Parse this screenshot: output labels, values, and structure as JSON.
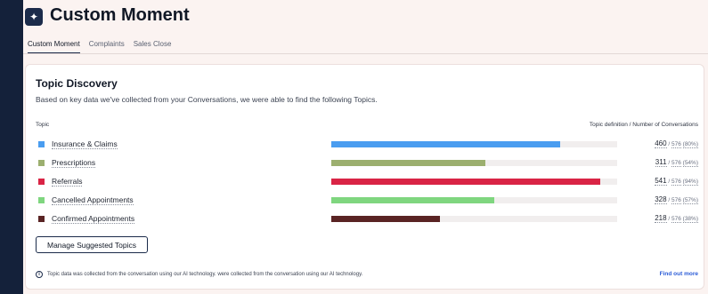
{
  "header": {
    "logo_glyph": "✦",
    "title": "Custom Moment"
  },
  "tabs": [
    {
      "label": "Custom Moment",
      "active": true
    },
    {
      "label": "Complaints",
      "active": false
    },
    {
      "label": "Sales Close",
      "active": false
    }
  ],
  "card": {
    "title": "Topic Discovery",
    "subtitle": "Based on key data we've collected from your Conversations, we were able to find the following Topics.",
    "col_topic": "Topic",
    "col_right": "Topic definition / Number of Conversations",
    "topics": [
      {
        "label": "Insurance & Claims",
        "count": "460",
        "total": "576",
        "pct": "(80%)",
        "fraction": 0.8,
        "color": "#4a9df0"
      },
      {
        "label": "Prescriptions",
        "count": "311",
        "total": "576",
        "pct": "(54%)",
        "fraction": 0.54,
        "color": "#9caf6f"
      },
      {
        "label": "Referrals",
        "count": "541",
        "total": "576",
        "pct": "(94%)",
        "fraction": 0.94,
        "color": "#d92445"
      },
      {
        "label": "Cancelled Appointments",
        "count": "328",
        "total": "576",
        "pct": "(57%)",
        "fraction": 0.57,
        "color": "#7fd67f"
      },
      {
        "label": "Confirmed Appointments",
        "count": "218",
        "total": "576",
        "pct": "(38%)",
        "fraction": 0.38,
        "color": "#5a2424"
      }
    ],
    "manage_button": "Manage Suggested Topics",
    "footnote": "Topic data was collected from the conversation using our AI technology. were collected from the conversation using our AI technology.",
    "find_more": "Find out more"
  }
}
